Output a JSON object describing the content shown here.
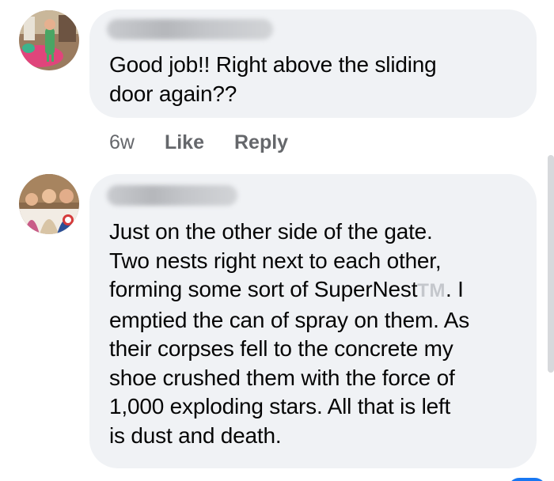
{
  "comments": [
    {
      "avatar_icon": "user-avatar-icon",
      "author_redacted": true,
      "text": "Good job!! Right above the  sliding\ndoor again??",
      "time": "6w",
      "like_label": "Like",
      "reply_label": "Reply"
    },
    {
      "avatar_icon": "user-avatar-icon",
      "author_redacted": true,
      "text_part1": "Just on the other side of the gate.\nTwo nests right next to each other,\nforming some sort of SuperNest",
      "tm_mark": "TM",
      "text_part2": ". I\nemptied the can of spray on them. As\ntheir corpses fell to the concrete my\nshoe crushed them with the force of\n1,000 exploding stars. All that is left\nis dust and death."
    }
  ],
  "colors": {
    "bubble": "#f0f2f5",
    "text": "#050505",
    "meta": "#65676b",
    "accent": "#1877f2"
  }
}
